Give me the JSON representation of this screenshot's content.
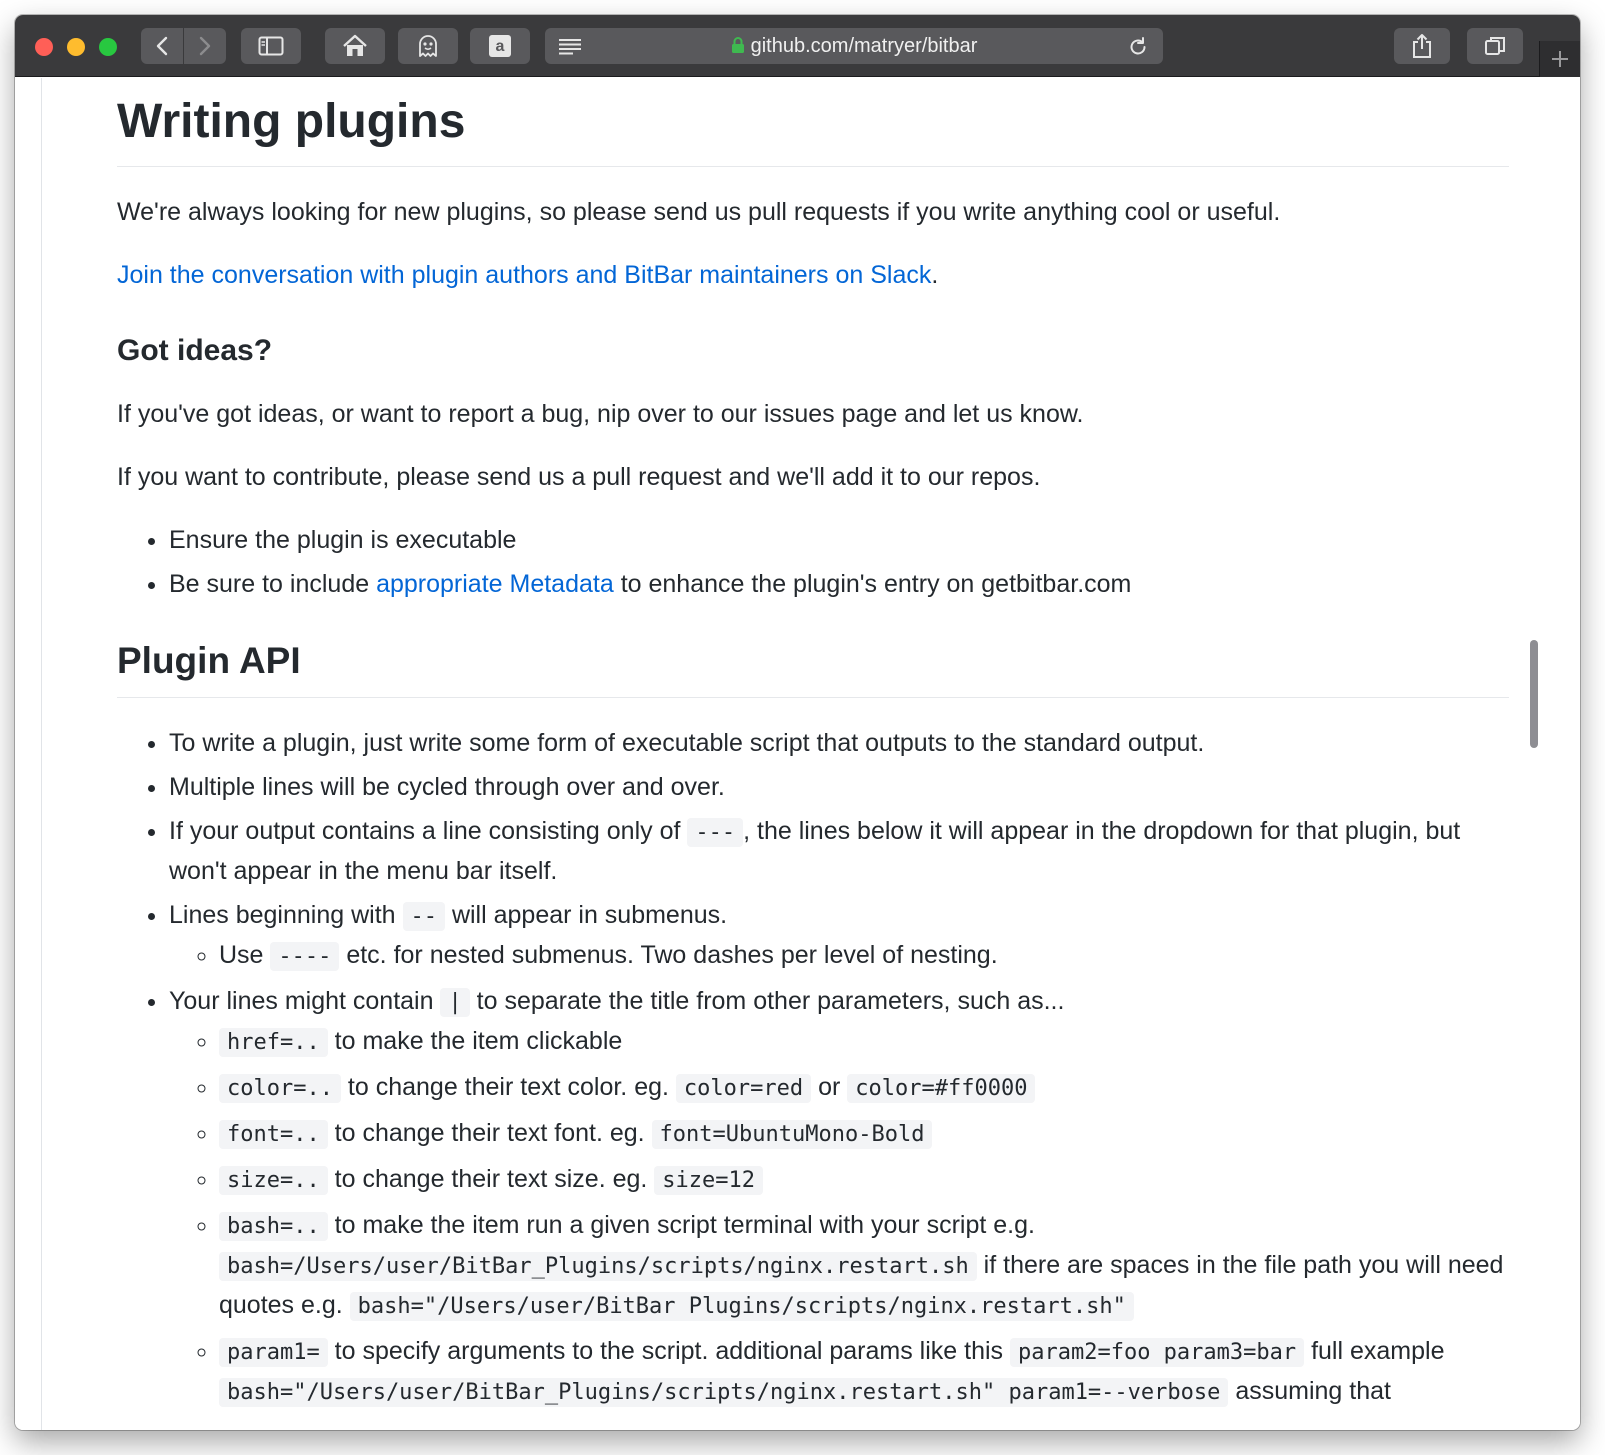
{
  "browser": {
    "url": "github.com/matryer/bitbar",
    "buttons": {
      "back": "back",
      "forward": "forward",
      "sidebar": "sidebar",
      "home": "home",
      "ghost": "ghost",
      "amazon": "a",
      "share": "share",
      "tabs": "tabs",
      "new_tab": "+"
    }
  },
  "article": {
    "writing_plugins": {
      "heading": "Writing plugins",
      "intro": "We're always looking for new plugins, so please send us pull requests if you write anything cool or useful.",
      "slack_link": "Join the conversation with plugin authors and BitBar maintainers on Slack",
      "slack_suffix": "."
    },
    "got_ideas": {
      "heading": "Got ideas?",
      "p1": "If you've got ideas, or want to report a bug, nip over to our issues page and let us know.",
      "p2": "If you want to contribute, please send us a pull request and we'll add it to our repos.",
      "bullet1": "Ensure the plugin is executable",
      "bullet2_pre": "Be sure to include ",
      "bullet2_link": "appropriate Metadata",
      "bullet2_post": " to enhance the plugin's entry on getbitbar.com"
    },
    "plugin_api": {
      "heading": "Plugin API",
      "b1": "To write a plugin, just write some form of executable script that outputs to the standard output.",
      "b2": "Multiple lines will be cycled through over and over.",
      "b3_pre": "If your output contains a line consisting only of ",
      "b3_code": "---",
      "b3_post": ", the lines below it will appear in the dropdown for that plugin, but won't appear in the menu bar itself.",
      "b4_pre": "Lines beginning with ",
      "b4_code": "--",
      "b4_post": " will appear in submenus.",
      "b4_sub_pre": "Use ",
      "b4_sub_code": "----",
      "b4_sub_post": " etc. for nested submenus. Two dashes per level of nesting.",
      "b5_pre": "Your lines might contain ",
      "b5_code": "|",
      "b5_post": " to separate the title from other parameters, such as...",
      "params": {
        "href_code": "href=..",
        "href_text": " to make the item clickable",
        "color_code": "color=..",
        "color_text": " to change their text color. eg. ",
        "color_ex1": "color=red",
        "color_or": " or ",
        "color_ex2": "color=#ff0000",
        "font_code": "font=..",
        "font_text": " to change their text font. eg. ",
        "font_ex": "font=UbuntuMono-Bold",
        "size_code": "size=..",
        "size_text": " to change their text size. eg. ",
        "size_ex": "size=12",
        "bash_code": "bash=..",
        "bash_text": " to make the item run a given script terminal with your script e.g. ",
        "bash_ex1": "bash=/Users/user/BitBar_Plugins/scripts/nginx.restart.sh",
        "bash_mid": " if there are spaces in the file path you will need quotes e.g. ",
        "bash_ex2": "bash=\"/Users/user/BitBar Plugins/scripts/nginx.restart.sh\"",
        "param_code": "param1=",
        "param_text": " to specify arguments to the script. additional params like this ",
        "param_ex1": "param2=foo param3=bar",
        "param_mid": " full example ",
        "param_ex2": "bash=\"/Users/user/BitBar_Plugins/scripts/nginx.restart.sh\" param1=--verbose",
        "param_post": " assuming that"
      }
    }
  },
  "colors": {
    "link": "#0366d6",
    "text": "#24292e",
    "toolbar": "#3a3a3c",
    "close": "#ff5f57",
    "minimize": "#febc2e",
    "maximize": "#28c840"
  }
}
